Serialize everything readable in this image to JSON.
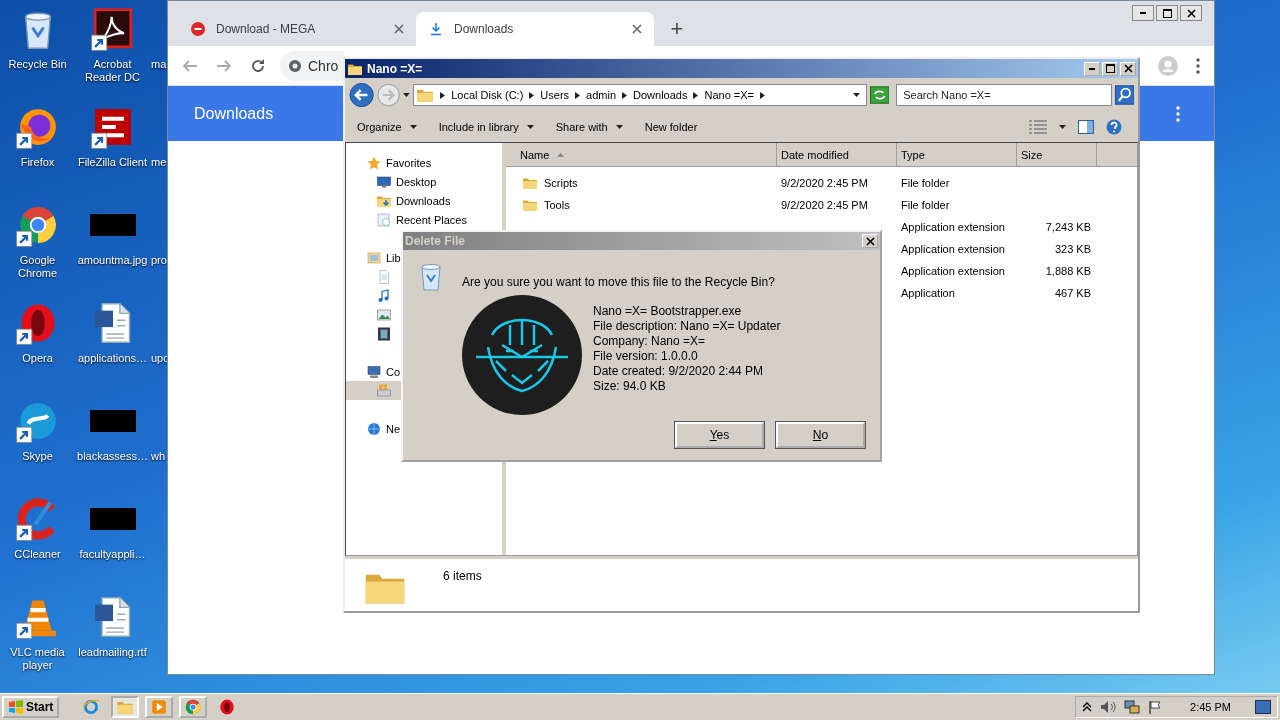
{
  "desktop": {
    "icon_columns": [
      {
        "icons": [
          {
            "label": "Recycle Bin",
            "kind": "recycle",
            "shortcut": false
          },
          {
            "label": "Firefox",
            "kind": "firefox",
            "shortcut": true
          },
          {
            "label": "Google Chrome",
            "kind": "chrome",
            "shortcut": true
          },
          {
            "label": "Opera",
            "kind": "opera",
            "shortcut": true
          },
          {
            "label": "Skype",
            "kind": "skype",
            "shortcut": true
          },
          {
            "label": "CCleaner",
            "kind": "ccleaner",
            "shortcut": true
          },
          {
            "label": "VLC media player",
            "kind": "vlc",
            "shortcut": true
          }
        ]
      },
      {
        "icons": [
          {
            "label": "Acrobat Reader DC",
            "kind": "pdf",
            "shortcut": true
          },
          {
            "label": "FileZilla Client",
            "kind": "filezilla",
            "shortcut": true
          },
          {
            "label": "amountma.jpg",
            "kind": "redacted",
            "shortcut": false
          },
          {
            "label": "applications…",
            "kind": "word",
            "shortcut": false
          },
          {
            "label": "blackassess…",
            "kind": "redacted",
            "shortcut": false
          },
          {
            "label": "facultyappli…",
            "kind": "redacted",
            "shortcut": false
          },
          {
            "label": "leadmailing.rtf",
            "kind": "word",
            "shortcut": false
          }
        ]
      },
      {
        "icons": [
          {
            "label": "ma"
          },
          {
            "label": "me"
          },
          {
            "label": "pro"
          },
          {
            "label": "upc"
          },
          {
            "label": "wh"
          }
        ]
      }
    ]
  },
  "chrome": {
    "tabs": [
      {
        "label": "Download - MEGA",
        "kind": "mega",
        "selected": false
      },
      {
        "label": "Downloads",
        "kind": "download",
        "selected": true
      }
    ],
    "new_tab": "+",
    "omnibox": {
      "value": "Chro"
    },
    "page_header": {
      "title": "Downloads"
    }
  },
  "explorer": {
    "title": "Nano =X=",
    "breadcrumb": [
      "Local Disk (C:)",
      "Users",
      "admin",
      "Downloads",
      "Nano =X="
    ],
    "search": {
      "placeholder": "Search Nano =X="
    },
    "toolbar": [
      {
        "label": "Organize",
        "dropdown": true
      },
      {
        "label": "Include in library",
        "dropdown": true
      },
      {
        "label": "Share with",
        "dropdown": true
      },
      {
        "label": "New folder",
        "dropdown": false
      }
    ],
    "nav": [
      {
        "label": "Favorites",
        "kind": "star",
        "selected": false,
        "children": [
          {
            "label": "Desktop",
            "kind": "desktop",
            "selected": false
          },
          {
            "label": "Downloads",
            "kind": "downloads",
            "selected": false
          },
          {
            "label": "Recent Places",
            "kind": "recent",
            "selected": false
          }
        ]
      },
      {
        "label": "Lib",
        "kind": "library",
        "selected": false,
        "children": [
          {
            "kind": "document",
            "selected": false
          },
          {
            "kind": "music",
            "selected": false
          },
          {
            "kind": "pictures",
            "selected": false
          },
          {
            "kind": "video",
            "selected": false
          }
        ]
      },
      {
        "label": "Co",
        "kind": "computer",
        "selected": false,
        "children": [
          {
            "kind": "drive",
            "selected": true
          }
        ]
      },
      {
        "label": "Ne",
        "kind": "network",
        "selected": false
      }
    ],
    "columns": [
      {
        "label": "Name",
        "sorted": true
      },
      {
        "label": "Date modified",
        "sorted": false
      },
      {
        "label": "Type",
        "sorted": false
      },
      {
        "label": "Size",
        "sorted": false
      }
    ],
    "rows": [
      {
        "name": "Scripts",
        "kind": "folder",
        "date": "9/2/2020 2:45 PM",
        "type": "File folder"
      },
      {
        "name": "Tools",
        "kind": "folder",
        "date": "9/2/2020 2:45 PM",
        "type": "File folder"
      },
      {
        "type": "Application extension",
        "size": "7,243 KB"
      },
      {
        "type": "Application extension",
        "size": "323 KB"
      },
      {
        "type": "Application extension",
        "size": "1,888 KB"
      },
      {
        "type": "Application",
        "size": "467 KB"
      }
    ],
    "status": {
      "count": "6 items"
    }
  },
  "dialog": {
    "title": "Delete File",
    "question": "Are you sure you want to move this file to the Recycle Bin?",
    "details": [
      "Nano =X= Bootstrapper.exe",
      "File description: Nano =X= Updater",
      "Company: Nano =X=",
      "File version: 1.0.0.0",
      "Date created: 9/2/2020 2:44 PM",
      "Size: 94.0 KB"
    ],
    "buttons": [
      "Yes",
      "No"
    ]
  },
  "taskbar": {
    "start": "Start",
    "apps": [
      {
        "kind": "ie",
        "open": false,
        "active": false
      },
      {
        "kind": "explorer",
        "open": true,
        "active": true
      },
      {
        "kind": "media",
        "open": true,
        "active": false
      },
      {
        "kind": "chrome",
        "open": true,
        "active": false
      },
      {
        "kind": "opera",
        "open": false,
        "active": false
      }
    ],
    "clock": "2:45 PM"
  }
}
